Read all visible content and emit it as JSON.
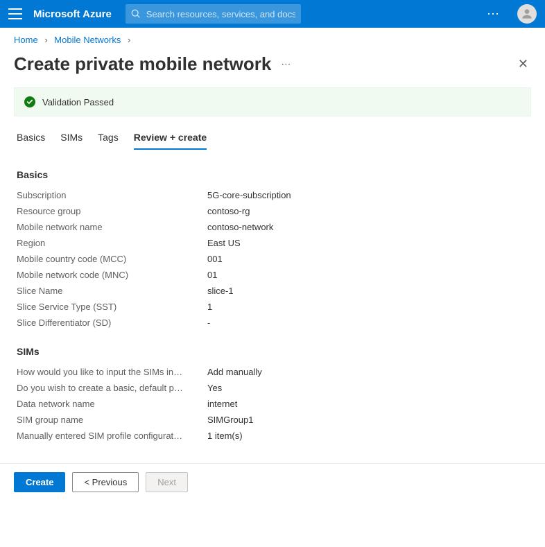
{
  "header": {
    "brand": "Microsoft Azure",
    "search_placeholder": "Search resources, services, and docs (G+/)"
  },
  "breadcrumb": {
    "items": [
      "Home",
      "Mobile Networks"
    ]
  },
  "page": {
    "title": "Create private mobile network"
  },
  "validation": {
    "message": "Validation Passed"
  },
  "tabs": {
    "items": [
      "Basics",
      "SIMs",
      "Tags",
      "Review + create"
    ],
    "active_index": 3
  },
  "sections": {
    "basics": {
      "title": "Basics",
      "rows": [
        {
          "label": "Subscription",
          "value": "5G-core-subscription"
        },
        {
          "label": "Resource group",
          "value": "contoso-rg"
        },
        {
          "label": "Mobile network name",
          "value": "contoso-network"
        },
        {
          "label": "Region",
          "value": "East US"
        },
        {
          "label": "Mobile country code (MCC)",
          "value": "001"
        },
        {
          "label": "Mobile network code (MNC)",
          "value": "01"
        },
        {
          "label": "Slice Name",
          "value": "slice-1"
        },
        {
          "label": "Slice Service Type (SST)",
          "value": "1"
        },
        {
          "label": "Slice Differentiator (SD)",
          "value": "-"
        }
      ]
    },
    "sims": {
      "title": "SIMs",
      "rows": [
        {
          "label": "How would you like to input the SIMs in…",
          "value": "Add manually"
        },
        {
          "label": "Do you wish to create a basic, default p…",
          "value": "Yes"
        },
        {
          "label": "Data network name",
          "value": "internet"
        },
        {
          "label": "SIM group name",
          "value": "SIMGroup1"
        },
        {
          "label": "Manually entered SIM profile configurat…",
          "value": "1 item(s)"
        }
      ]
    }
  },
  "footer": {
    "create": "Create",
    "previous": "< Previous",
    "next": "Next"
  }
}
